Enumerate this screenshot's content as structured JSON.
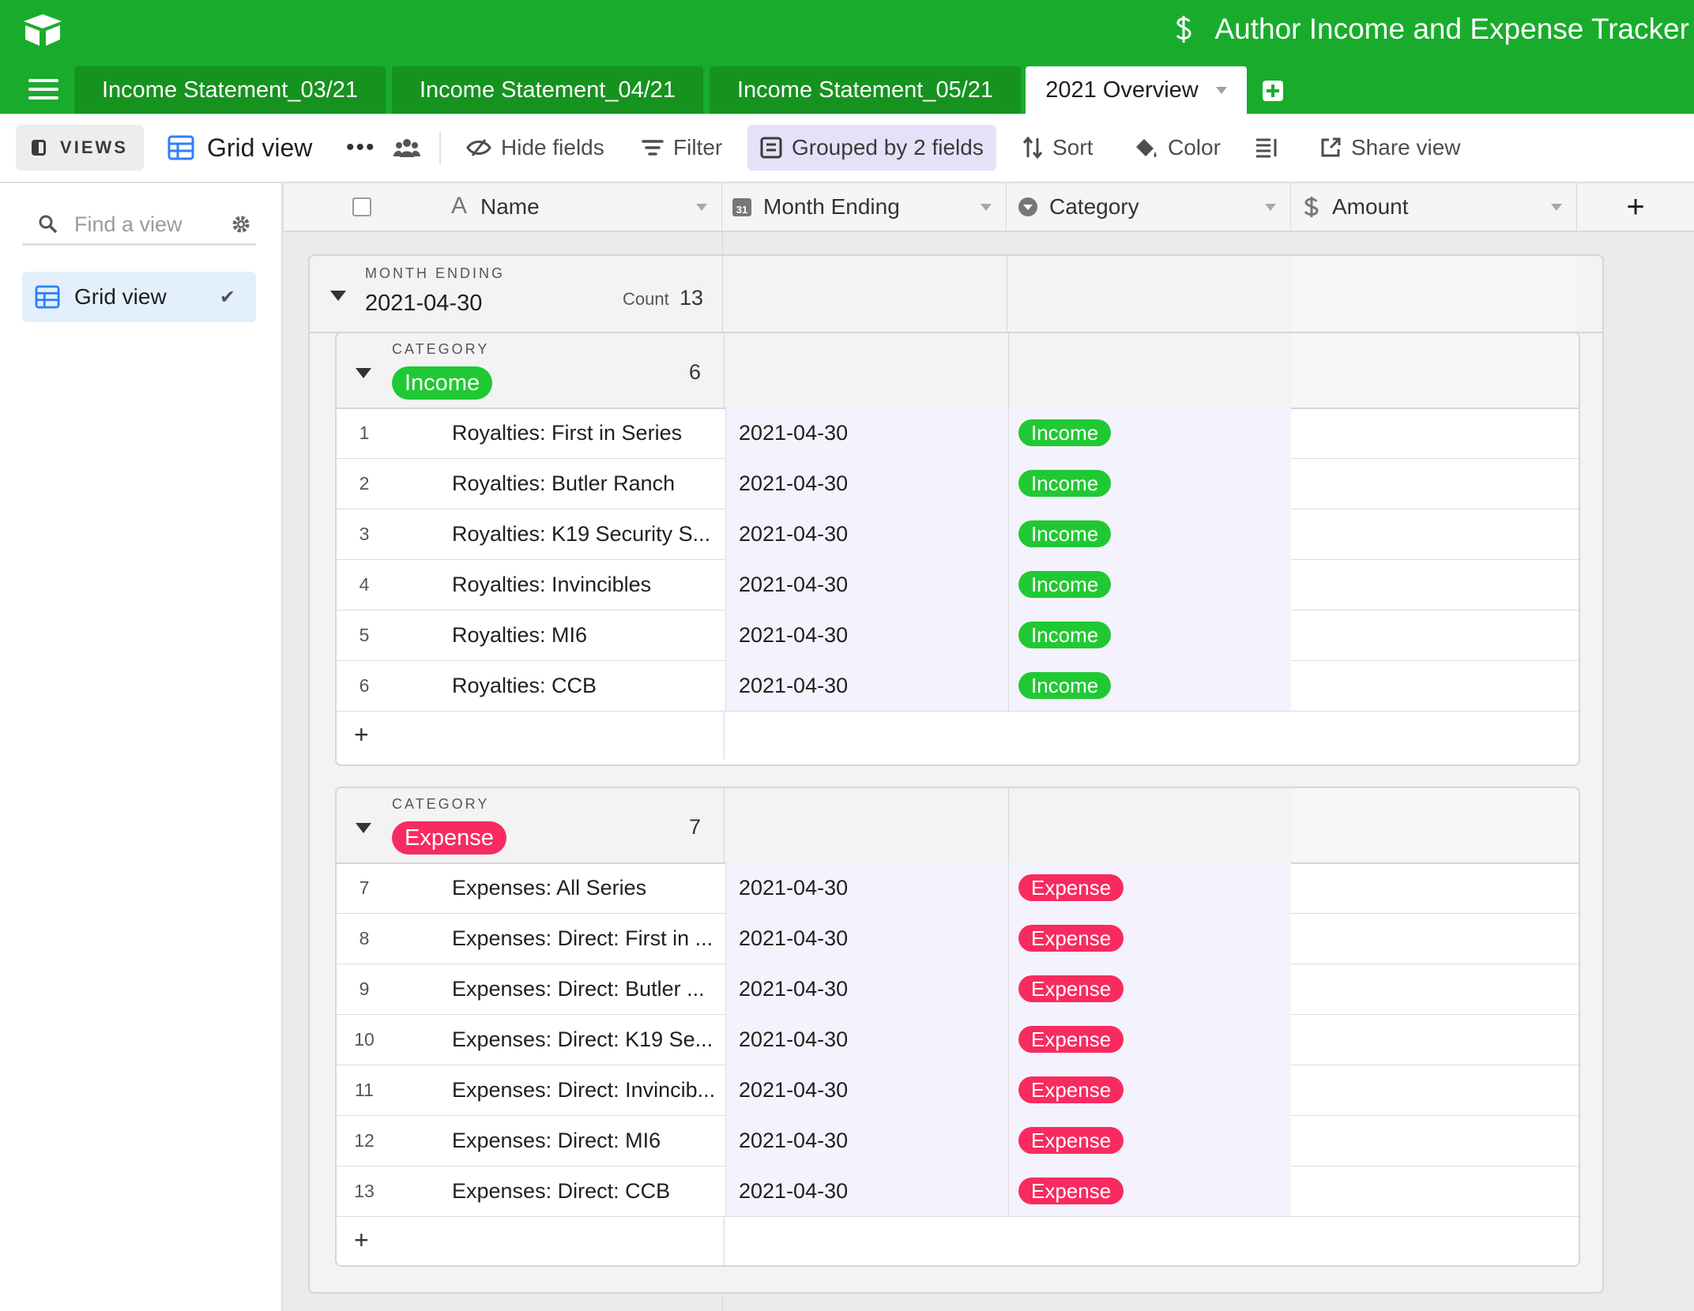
{
  "base_title": "Author Income and Expense Tracker",
  "tabs": [
    {
      "label": "Income Statement_03/21"
    },
    {
      "label": "Income Statement_04/21"
    },
    {
      "label": "Income Statement_05/21"
    },
    {
      "label": "2021 Overview"
    }
  ],
  "toolbar": {
    "views_label": "VIEWS",
    "view_name": "Grid view",
    "hide_fields": "Hide fields",
    "filter": "Filter",
    "grouped": "Grouped by 2 fields",
    "sort": "Sort",
    "color": "Color",
    "share_view": "Share view"
  },
  "sidebar": {
    "find_placeholder": "Find a view",
    "views": [
      {
        "label": "Grid view"
      }
    ]
  },
  "columns": [
    {
      "label": "Name"
    },
    {
      "label": "Month Ending"
    },
    {
      "label": "Category"
    },
    {
      "label": "Amount"
    }
  ],
  "group1": {
    "field_label": "MONTH ENDING",
    "value": "2021-04-30",
    "count_label": "Count",
    "count": "13"
  },
  "subgroups": [
    {
      "field_label": "CATEGORY",
      "value": "Income",
      "count": "6",
      "color": "#20c933",
      "rows": [
        {
          "num": "1",
          "name": "Royalties: First in Series",
          "date": "2021-04-30",
          "category": "Income"
        },
        {
          "num": "2",
          "name": "Royalties: Butler Ranch",
          "date": "2021-04-30",
          "category": "Income"
        },
        {
          "num": "3",
          "name": "Royalties: K19 Security S...",
          "date": "2021-04-30",
          "category": "Income"
        },
        {
          "num": "4",
          "name": "Royalties: Invincibles",
          "date": "2021-04-30",
          "category": "Income"
        },
        {
          "num": "5",
          "name": "Royalties: MI6",
          "date": "2021-04-30",
          "category": "Income"
        },
        {
          "num": "6",
          "name": "Royalties: CCB",
          "date": "2021-04-30",
          "category": "Income"
        }
      ]
    },
    {
      "field_label": "CATEGORY",
      "value": "Expense",
      "count": "7",
      "color": "#f82b60",
      "rows": [
        {
          "num": "7",
          "name": "Expenses: All Series",
          "date": "2021-04-30",
          "category": "Expense"
        },
        {
          "num": "8",
          "name": "Expenses: Direct: First in ...",
          "date": "2021-04-30",
          "category": "Expense"
        },
        {
          "num": "9",
          "name": "Expenses: Direct: Butler ...",
          "date": "2021-04-30",
          "category": "Expense"
        },
        {
          "num": "10",
          "name": "Expenses: Direct: K19 Se...",
          "date": "2021-04-30",
          "category": "Expense"
        },
        {
          "num": "11",
          "name": "Expenses: Direct: Invincib...",
          "date": "2021-04-30",
          "category": "Expense"
        },
        {
          "num": "12",
          "name": "Expenses: Direct: MI6",
          "date": "2021-04-30",
          "category": "Expense"
        },
        {
          "num": "13",
          "name": "Expenses: Direct: CCB",
          "date": "2021-04-30",
          "category": "Expense"
        }
      ]
    }
  ],
  "colors": {
    "brand": "#19ac2c",
    "income": "#20c933",
    "expense": "#f82b60",
    "grouped_bg": "#e6e1f8"
  }
}
